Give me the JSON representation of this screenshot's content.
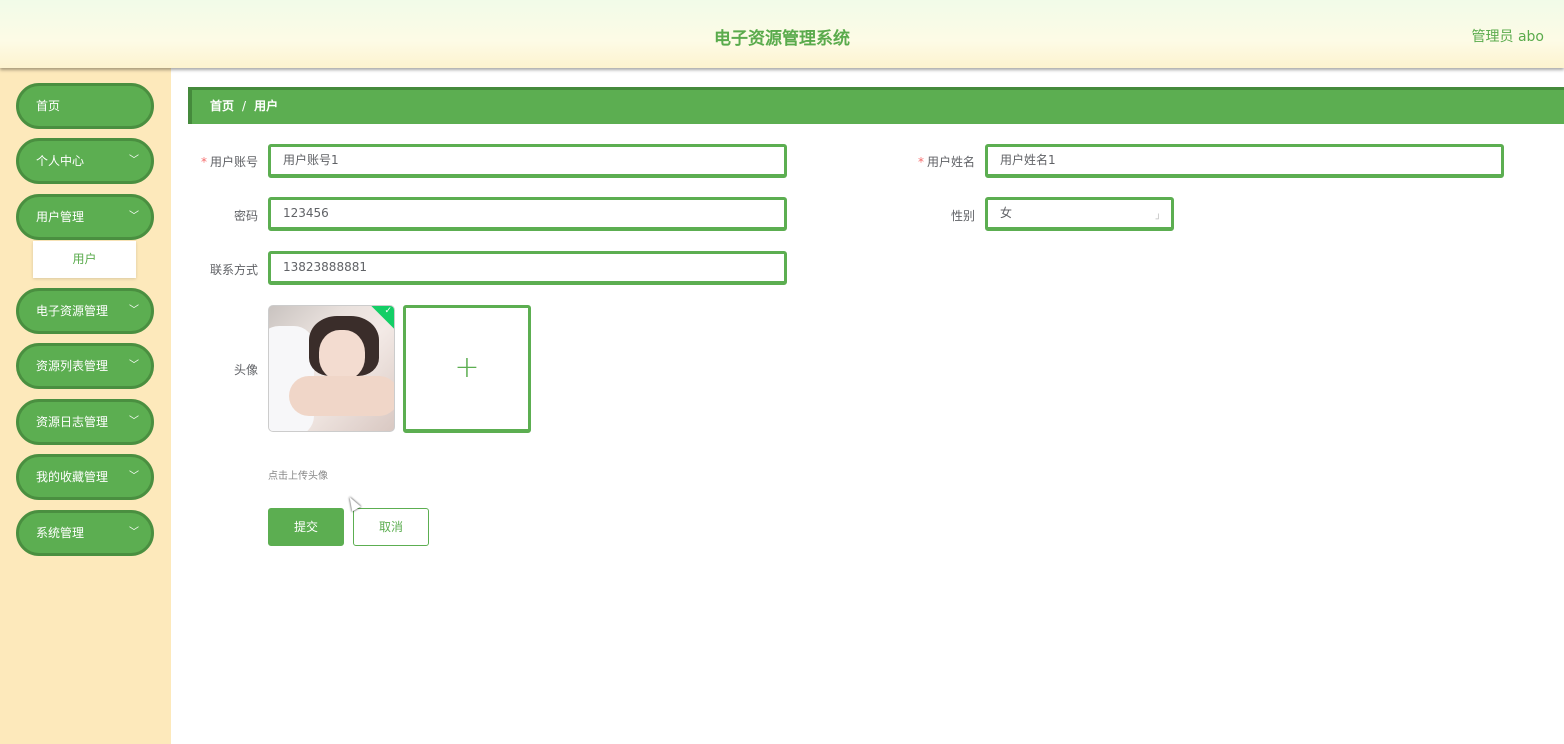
{
  "header": {
    "title": "电子资源管理系统",
    "user": "管理员 abo"
  },
  "sidebar": {
    "items": [
      {
        "label": "首页",
        "has_chevron": false
      },
      {
        "label": "个人中心",
        "has_chevron": true
      },
      {
        "label": "用户管理",
        "has_chevron": true
      },
      {
        "label": "电子资源管理",
        "has_chevron": true
      },
      {
        "label": "资源列表管理",
        "has_chevron": true
      },
      {
        "label": "资源日志管理",
        "has_chevron": true
      },
      {
        "label": "我的收藏管理",
        "has_chevron": true
      },
      {
        "label": "系统管理",
        "has_chevron": true
      }
    ],
    "sub_item": "用户",
    "chevron": "﹀"
  },
  "breadcrumb": {
    "home": "首页",
    "sep": "/",
    "current": "用户"
  },
  "form": {
    "required_mark": "*",
    "account": {
      "label": "用户账号",
      "value": "用户账号1"
    },
    "name": {
      "label": "用户姓名",
      "value": "用户姓名1"
    },
    "password": {
      "label": "密码",
      "value": "123456"
    },
    "gender": {
      "label": "性别",
      "value": "女"
    },
    "phone": {
      "label": "联系方式",
      "value": "13823888881"
    },
    "avatar": {
      "label": "头像",
      "hint": "点击上传头像",
      "upload_icon": "+",
      "check": "✓"
    },
    "submit": "提交",
    "cancel": "取消"
  },
  "colors": {
    "primary": "#5cae51",
    "sidebar_bg": "#fde9bb"
  }
}
